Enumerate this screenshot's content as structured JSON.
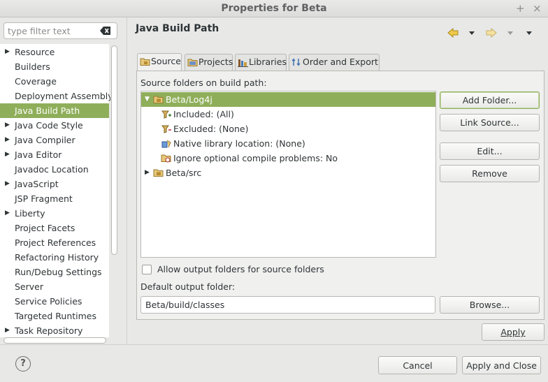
{
  "window": {
    "title": "Properties for Beta",
    "maximize_glyph": "+",
    "close_glyph": "×"
  },
  "filter": {
    "placeholder": "type filter text",
    "value": ""
  },
  "nav_tree": {
    "items": [
      {
        "label": "Resource",
        "expandable": true
      },
      {
        "label": "Builders",
        "expandable": false
      },
      {
        "label": "Coverage",
        "expandable": false
      },
      {
        "label": "Deployment Assembly",
        "expandable": false
      },
      {
        "label": "Java Build Path",
        "expandable": false,
        "selected": true
      },
      {
        "label": "Java Code Style",
        "expandable": true
      },
      {
        "label": "Java Compiler",
        "expandable": true
      },
      {
        "label": "Java Editor",
        "expandable": true
      },
      {
        "label": "Javadoc Location",
        "expandable": false
      },
      {
        "label": "JavaScript",
        "expandable": true
      },
      {
        "label": "JSP Fragment",
        "expandable": false
      },
      {
        "label": "Liberty",
        "expandable": true
      },
      {
        "label": "Project Facets",
        "expandable": false
      },
      {
        "label": "Project References",
        "expandable": false
      },
      {
        "label": "Refactoring History",
        "expandable": false
      },
      {
        "label": "Run/Debug Settings",
        "expandable": false
      },
      {
        "label": "Server",
        "expandable": false
      },
      {
        "label": "Service Policies",
        "expandable": false
      },
      {
        "label": "Targeted Runtimes",
        "expandable": false
      },
      {
        "label": "Task Repository",
        "expandable": true
      }
    ]
  },
  "page": {
    "title": "Java Build Path"
  },
  "tabs": [
    {
      "label": "Source",
      "icon": "source-folder-icon",
      "active": true
    },
    {
      "label": "Projects",
      "icon": "projects-icon",
      "active": false
    },
    {
      "label": "Libraries",
      "icon": "libraries-icon",
      "active": false
    },
    {
      "label": "Order and Export",
      "icon": "order-export-icon",
      "active": false
    }
  ],
  "source": {
    "heading": "Source folders on build path:",
    "tree": [
      {
        "label": "Beta/Log4j",
        "depth": 0,
        "expanded": true,
        "selected": true,
        "icon": "package-folder-icon"
      },
      {
        "label": "Included: (All)",
        "depth": 1,
        "icon": "inclusion-filter-icon"
      },
      {
        "label": "Excluded: (None)",
        "depth": 1,
        "icon": "exclusion-filter-icon"
      },
      {
        "label": "Native library location: (None)",
        "depth": 1,
        "icon": "native-library-icon"
      },
      {
        "label": "Ignore optional compile problems: No",
        "depth": 1,
        "icon": "ignore-problems-icon"
      },
      {
        "label": "Beta/src",
        "depth": 0,
        "expanded": false,
        "icon": "package-folder-icon"
      }
    ],
    "buttons": {
      "add_folder": "Add Folder...",
      "link_source": "Link Source...",
      "edit": "Edit...",
      "remove": "Remove"
    },
    "allow_output_label": "Allow output folders for source folders",
    "allow_output_checked": false,
    "default_output_label": "Default output folder:",
    "default_output_value": "Beta/build/classes",
    "browse": "Browse..."
  },
  "actions": {
    "apply": "Apply",
    "cancel": "Cancel",
    "apply_and_close": "Apply and Close",
    "help": "?"
  },
  "colors": {
    "selection": "#8fae5a",
    "window_bg": "#e8e8e7",
    "panel_bg": "#f0f0ef"
  }
}
